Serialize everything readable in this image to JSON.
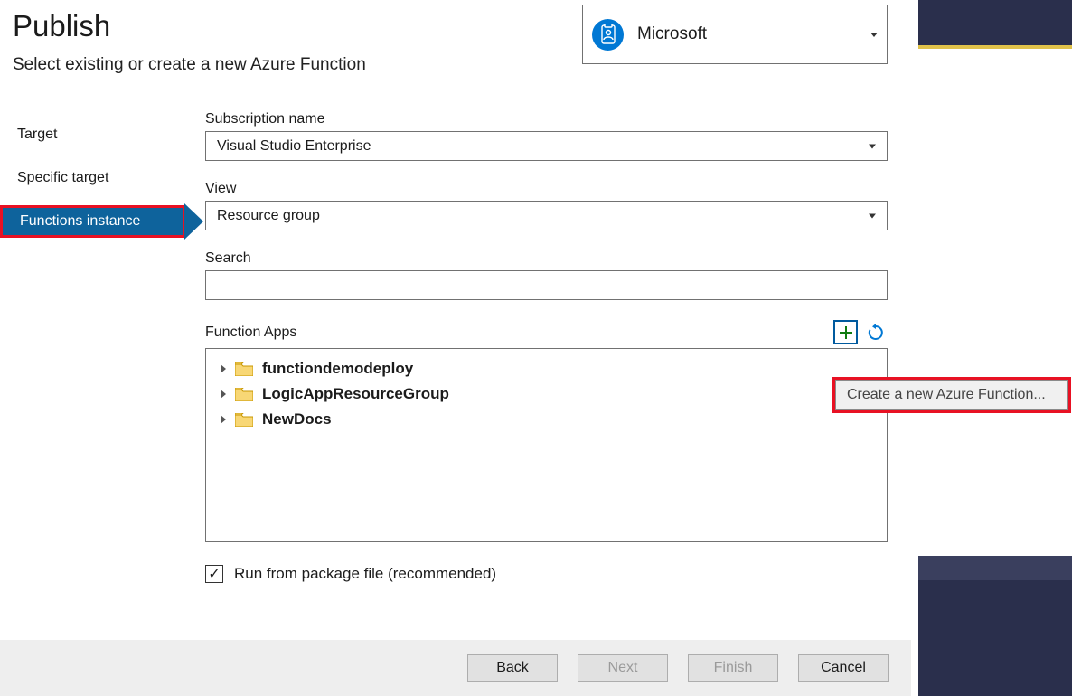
{
  "header": {
    "title": "Publish",
    "subtitle": "Select existing or create a new Azure Function"
  },
  "account": {
    "label": "Microsoft"
  },
  "nav": {
    "items": [
      "Target",
      "Specific target",
      "Functions instance"
    ],
    "active_index": 2
  },
  "fields": {
    "subscription_label": "Subscription name",
    "subscription_value": "Visual Studio Enterprise",
    "view_label": "View",
    "view_value": "Resource group",
    "search_label": "Search",
    "search_value": "",
    "function_apps_label": "Function Apps"
  },
  "tree": {
    "items": [
      "functiondemodeploy",
      "LogicAppResourceGroup",
      "NewDocs"
    ]
  },
  "checkbox": {
    "label": "Run from package file (recommended)",
    "checked": true
  },
  "footer": {
    "back": "Back",
    "next": "Next",
    "finish": "Finish",
    "cancel": "Cancel"
  },
  "tooltip": {
    "text": "Create a new Azure Function..."
  }
}
